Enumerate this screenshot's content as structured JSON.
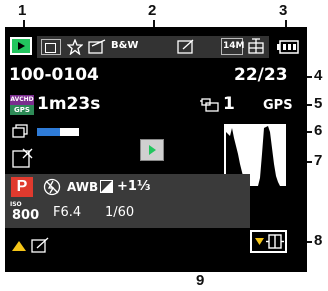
{
  "callouts": [
    "1",
    "2",
    "3",
    "4",
    "5",
    "6",
    "7",
    "8",
    "9"
  ],
  "screen": {
    "top_bar": {
      "mode_icon": "playback-icon",
      "icons": [
        "preview-icon",
        "favorite-star-icon",
        "print-set-icon",
        "bw-icon",
        "protect-icon",
        "14m-size-icon",
        "drive-mode-icon",
        "battery-icon"
      ],
      "bw_label": "B&W",
      "size_label": "14M"
    },
    "folder_file": "100-0104",
    "count": "22/23",
    "avchd_badge_top": "AVCHD",
    "avchd_badge_bottom": "GPS",
    "record_time": "1m23s",
    "copy_count": "1",
    "gps_label": "GPS",
    "progress_fraction": 0.55,
    "mode_letter": "P",
    "settings": {
      "awb": "AWB",
      "exposure": "+1⅓"
    },
    "iso_label": "ISO",
    "iso_value": "800",
    "aperture": "F6.4",
    "shutter": "1/60",
    "colors": {
      "playback_green": "#22c55e",
      "mode_red": "#e03a2e",
      "yellow": "#f5c518",
      "progress_blue": "#2f7cd8"
    }
  }
}
